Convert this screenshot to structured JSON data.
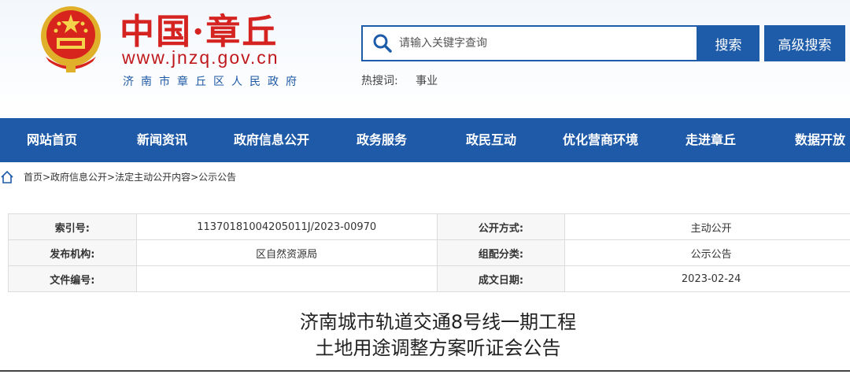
{
  "header": {
    "site_title": "中国·章丘",
    "site_url": "www.jnzq.gov.cn",
    "site_subtitle": "济南市章丘区人民政府"
  },
  "search": {
    "placeholder": "请输入关键字查询",
    "search_button": "搜索",
    "advanced_button": "高级搜索",
    "hot_label": "热搜词:",
    "hot_word": "事业"
  },
  "nav": [
    {
      "label": "网站首页"
    },
    {
      "label": "新闻资讯"
    },
    {
      "label": "政府信息公开"
    },
    {
      "label": "政务服务"
    },
    {
      "label": "政民互动"
    },
    {
      "label": "优化营商环境"
    },
    {
      "label": "走进章丘"
    },
    {
      "label": "数据开放"
    }
  ],
  "breadcrumb": "首页>政府信息公开>法定主动公开内容>公示公告",
  "meta": {
    "index_label": "索引号:",
    "index_value": "11370181004205011J/2023-00970",
    "open_label": "公开方式:",
    "open_value": "主动公开",
    "publisher_label": "发布机构:",
    "publisher_value": "区自然资源局",
    "category_label": "组配分类:",
    "category_value": "公示公告",
    "docno_label": "文件编号:",
    "docno_value": "",
    "date_label": "成文日期:",
    "date_value": "2023-02-24"
  },
  "document": {
    "title_line1": "济南城市轨道交通8号线一期工程",
    "title_line2": "土地用途调整方案听证会公告"
  },
  "colors": {
    "nav_bg": "#1e5aa8",
    "title_red": "#d42320",
    "subtitle_blue": "#1f5aa6"
  }
}
